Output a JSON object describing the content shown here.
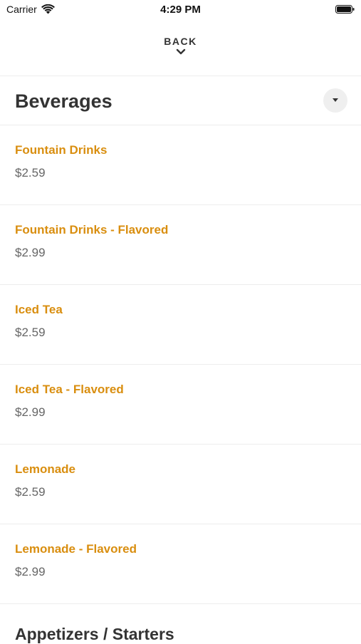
{
  "status_bar": {
    "carrier": "Carrier",
    "time": "4:29 PM",
    "icons": [
      "wifi-icon",
      "battery-icon"
    ]
  },
  "nav": {
    "back_label": "BACK",
    "back_icon": "chevron-down-icon"
  },
  "section": {
    "title": "Beverages",
    "toggle_icon": "caret-down-icon"
  },
  "items": [
    {
      "name": "Fountain Drinks",
      "price": "$2.59"
    },
    {
      "name": "Fountain Drinks - Flavored",
      "price": "$2.99"
    },
    {
      "name": "Iced Tea",
      "price": "$2.59"
    },
    {
      "name": "Iced Tea - Flavored",
      "price": "$2.99"
    },
    {
      "name": "Lemonade",
      "price": "$2.59"
    },
    {
      "name": "Lemonade - Flavored",
      "price": "$2.99"
    }
  ],
  "next_section": {
    "title": "Appetizers / Starters"
  },
  "colors": {
    "item_name": "#d98e0f",
    "price": "#666666",
    "title": "#333333",
    "divider": "#ededed"
  }
}
